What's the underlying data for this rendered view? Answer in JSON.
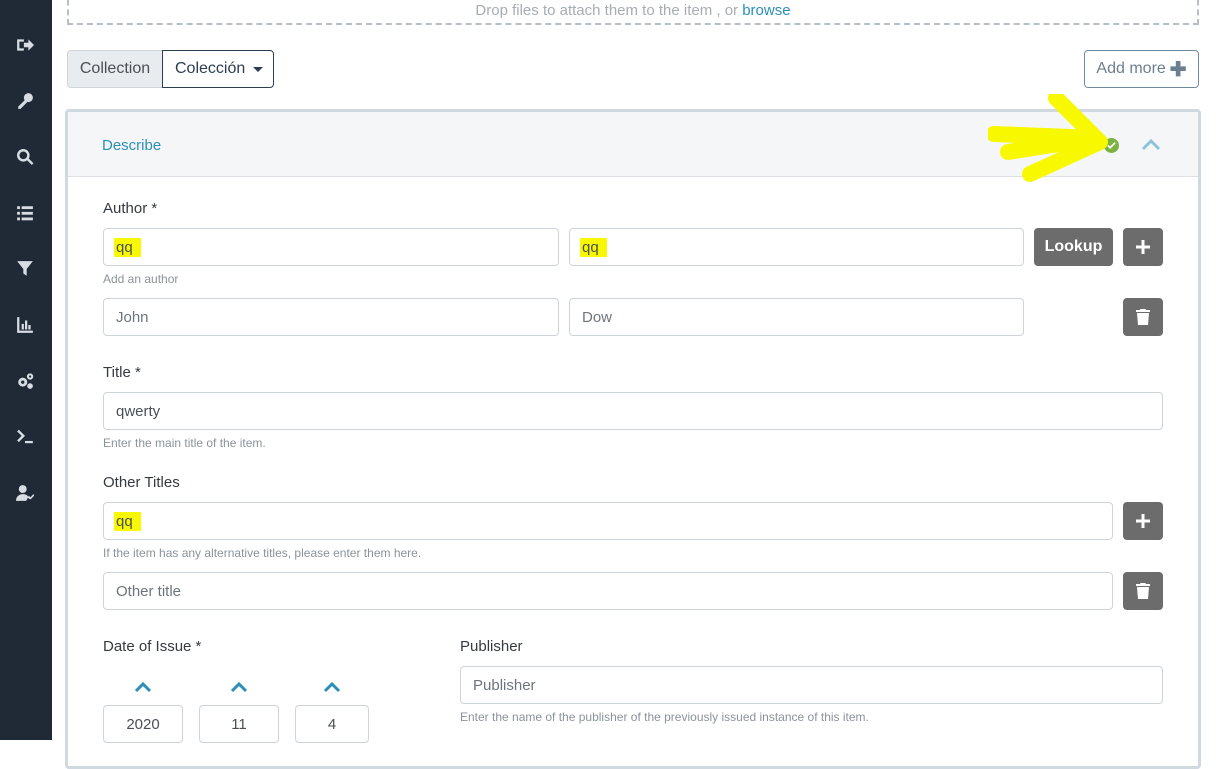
{
  "dropzone": {
    "text": "Drop files to attach them to the item , or",
    "link": "browse"
  },
  "collection": {
    "label": "Collection",
    "selected": "Colección"
  },
  "add_more": {
    "label": "Add more"
  },
  "panel": {
    "title": "Describe"
  },
  "author": {
    "label": "Author *",
    "first_value_1": "qq",
    "last_value_1": "qq",
    "lookup_label": "Lookup",
    "hint": "Add an author",
    "first_placeholder": "John",
    "last_placeholder": "Dow"
  },
  "title": {
    "label": "Title *",
    "value": "qwerty",
    "hint": "Enter the main title of the item."
  },
  "other_titles": {
    "label": "Other Titles",
    "value": "qq",
    "hint": "If the item has any alternative titles, please enter them here.",
    "placeholder": "Other title"
  },
  "date_issue": {
    "label": "Date of Issue *",
    "year": "2020",
    "month": "11",
    "day": "4"
  },
  "publisher": {
    "label": "Publisher",
    "placeholder": "Publisher",
    "hint": "Enter the name of the publisher of the previously issued instance of this item."
  },
  "colors": {
    "sidebar": "#1f2a36",
    "accent": "#2b8fb7",
    "highlight": "#f8f800",
    "success": "#7bb342"
  },
  "sidebar_icons": [
    "sign-out-icon",
    "key-icon",
    "search-icon",
    "list-icon",
    "filter-icon",
    "chart-icon",
    "cogs-icon",
    "terminal-icon",
    "user-check-icon"
  ]
}
